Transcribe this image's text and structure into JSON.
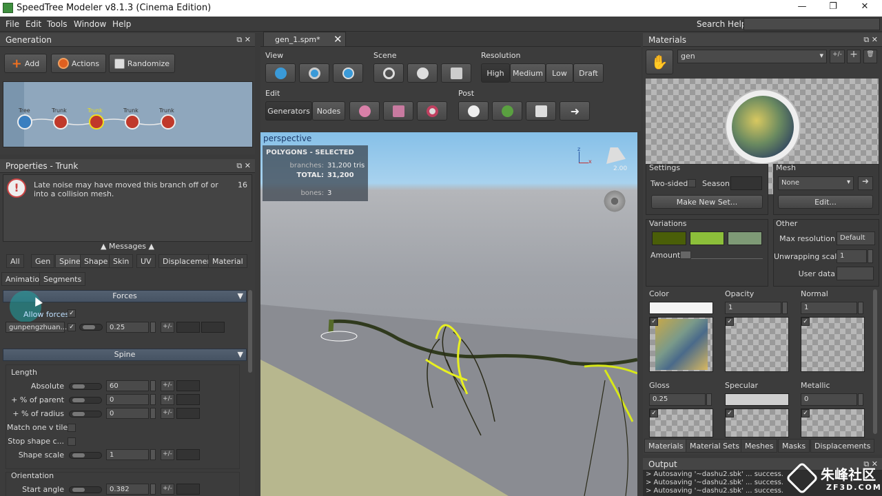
{
  "window": {
    "title": "SpeedTree Modeler v8.1.3 (Cinema Edition)"
  },
  "menu": {
    "items": [
      "File",
      "Edit",
      "Tools",
      "Window",
      "Help"
    ],
    "search_label": "Search Help:"
  },
  "generation": {
    "title": "Generation",
    "buttons": {
      "add": "Add",
      "actions": "Actions",
      "randomize": "Randomize"
    },
    "nodes": [
      "Tree",
      "Trunk",
      "Trunk",
      "Trunk",
      "Trunk"
    ]
  },
  "properties": {
    "title": "Properties - Trunk",
    "message": "Late noise may have moved this branch off of or into a collision mesh.",
    "message_count": "16",
    "messages_label": "Messages",
    "tabs_row1": [
      "All",
      "Gen",
      "Spine",
      "Shape",
      "Skin",
      "UV",
      "Displacement",
      "Material"
    ],
    "tabs_row2": [
      "Animation",
      "Segments"
    ],
    "forces": {
      "header": "Forces",
      "allow_label": "Allow forces",
      "force_name": "gunpengzhuan...",
      "force_value": "0.25",
      "plusminus": "+/-"
    },
    "spine": {
      "header": "Spine",
      "length_group": "Length",
      "absolute_label": "Absolute",
      "absolute_value": "60",
      "pct_parent_label": "+ % of parent",
      "pct_parent_value": "0",
      "pct_radius_label": "+ % of radius",
      "pct_radius_value": "0",
      "match_label": "Match one v tile",
      "stop_label": "Stop shape c...",
      "shape_scale_label": "Shape scale",
      "shape_scale_value": "1",
      "orientation_group": "Orientation",
      "start_angle_label": "Start angle",
      "start_angle_value": "0.382"
    }
  },
  "document": {
    "tab": "gen_1.spm*"
  },
  "toolbar": {
    "view_label": "View",
    "scene_label": "Scene",
    "resolution_label": "Resolution",
    "resolution_options": [
      "High",
      "Medium",
      "Low",
      "Draft"
    ],
    "edit_label": "Edit",
    "post_label": "Post",
    "edit_modes": [
      "Generators",
      "Nodes"
    ]
  },
  "viewport": {
    "camera": "perspective",
    "stats_title": "POLYGONS - SELECTED",
    "branches_label": "branches:",
    "branches_value": "31,200 tris",
    "total_label": "TOTAL:",
    "total_value": "31,200",
    "bones_label": "bones:",
    "bones_value": "3",
    "light_value": "2.00",
    "axis_z": "z",
    "axis_x": "x"
  },
  "materials": {
    "title": "Materials",
    "selected": "gen",
    "plusminus": "+/-",
    "settings": {
      "label": "Settings",
      "two_sided": "Two-sided",
      "season": "Season",
      "make_new_set": "Make New Set..."
    },
    "mesh": {
      "label": "Mesh",
      "value": "None",
      "edit": "Edit..."
    },
    "variations": {
      "label": "Variations",
      "amount": "Amount",
      "colors": [
        "#4a5e08",
        "#8cbf3a",
        "#7e9a76"
      ]
    },
    "other": {
      "label": "Other",
      "max_resolution": "Max resolution",
      "max_resolution_value": "Default",
      "unwrapping_scale": "Unwrapping scale",
      "unwrapping_value": "1",
      "user_data": "User data"
    },
    "channels": {
      "color": "Color",
      "opacity": "Opacity",
      "opacity_value": "1",
      "normal": "Normal",
      "normal_value": "1",
      "gloss": "Gloss",
      "gloss_value": "0.25",
      "specular": "Specular",
      "metallic": "Metallic",
      "metallic_value": "0"
    },
    "bottom_tabs": [
      "Materials",
      "Material Sets",
      "Meshes",
      "Masks",
      "Displacements"
    ]
  },
  "output": {
    "title": "Output",
    "lines": [
      "> Autosaving '~dashu2.sbk' ... success.",
      "> Autosaving '~dashu2.sbk' ... success.",
      "> Autosaving '~dashu2.sbk' ... success."
    ]
  },
  "watermark": {
    "text": "朱峰社区",
    "sub": "ZF3D.COM"
  }
}
